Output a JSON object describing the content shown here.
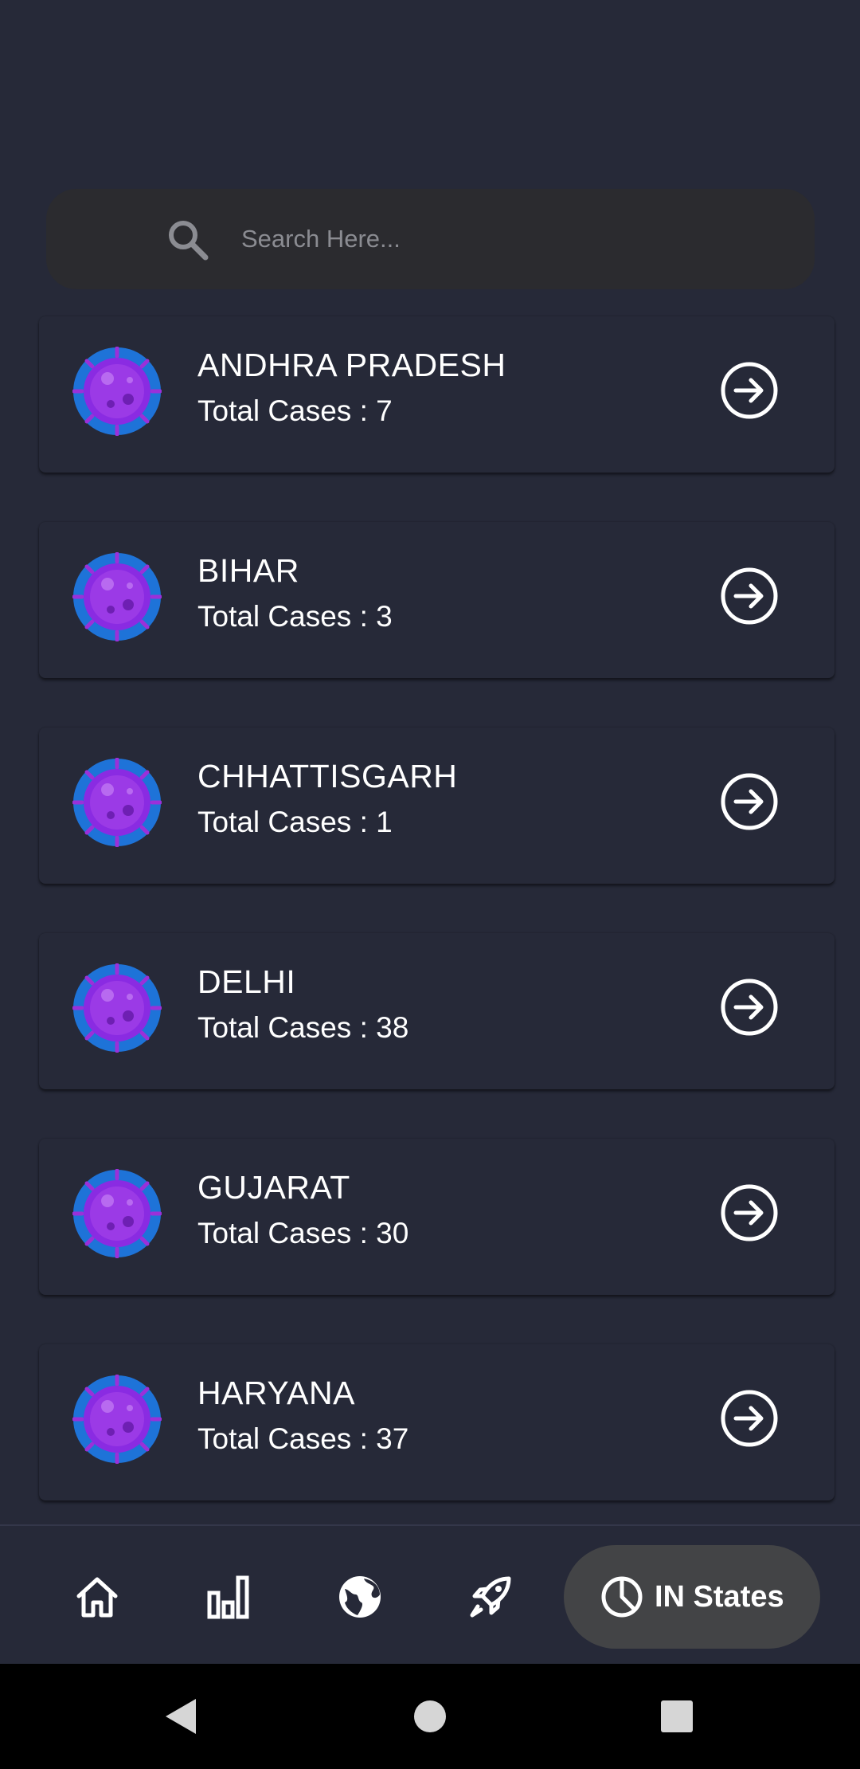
{
  "search": {
    "placeholder": "Search Here...",
    "icon": "search-icon"
  },
  "states": [
    {
      "name": "ANDHRA PRADESH",
      "cases": "Total Cases : 7"
    },
    {
      "name": "BIHAR",
      "cases": "Total Cases : 3"
    },
    {
      "name": "CHHATTISGARH",
      "cases": "Total Cases : 1"
    },
    {
      "name": "DELHI",
      "cases": "Total Cases : 38"
    },
    {
      "name": "GUJARAT",
      "cases": "Total Cases : 30"
    },
    {
      "name": "HARYANA",
      "cases": "Total Cases : 37"
    }
  ],
  "bottom_nav": {
    "items": [
      "home-icon",
      "bar-chart-icon",
      "globe-icon",
      "rocket-icon"
    ],
    "active": {
      "icon": "pie-chart-icon",
      "label": "IN States"
    }
  },
  "system_nav": [
    "back-button",
    "home-button",
    "recents-button"
  ],
  "colors": {
    "background": "#262938",
    "search_bg": "#2b2b2f",
    "active_pill": "#434446",
    "virus_outer": "#1e73d8",
    "virus_inner": "#8a2be2"
  }
}
